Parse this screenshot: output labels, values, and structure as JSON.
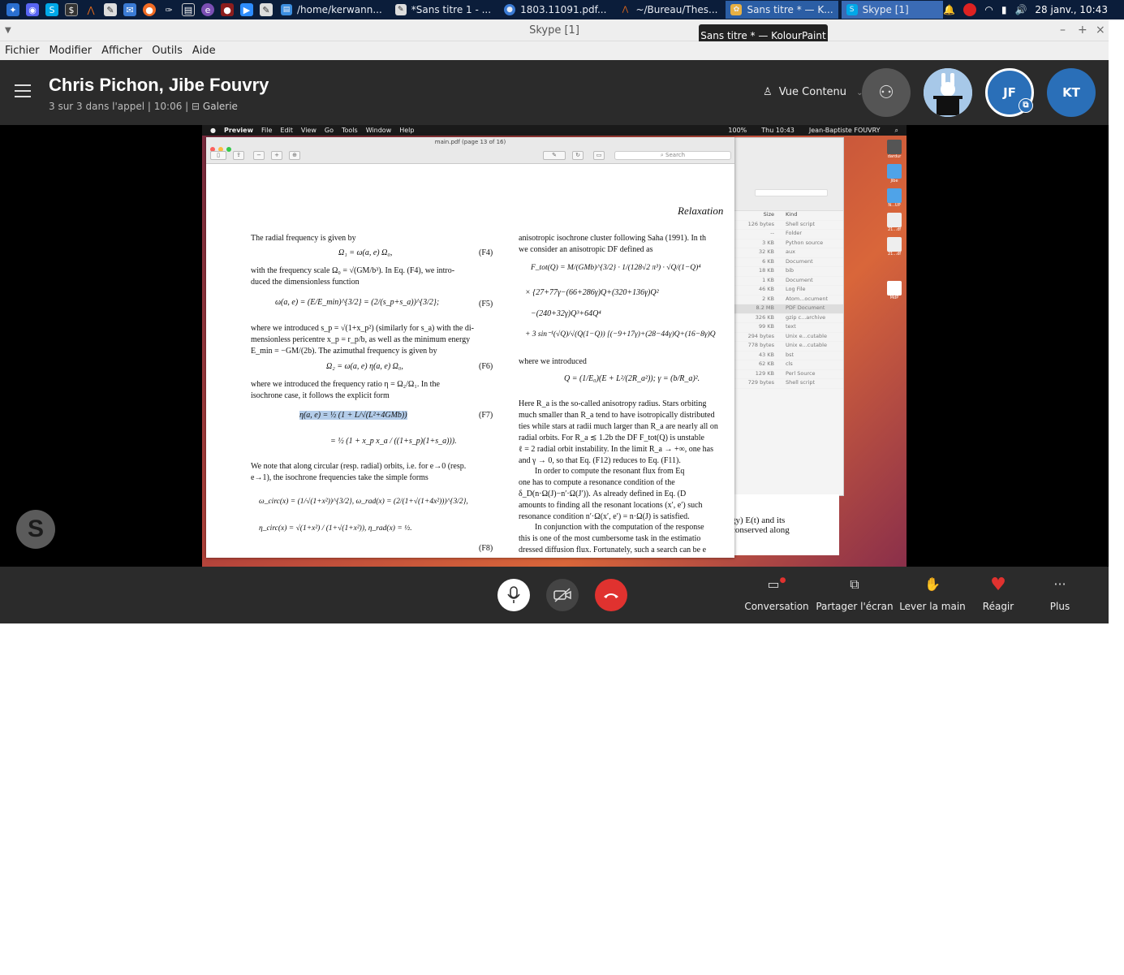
{
  "taskbar": {
    "tasks": [
      {
        "label": "/home/kerwann..."
      },
      {
        "label": "*Sans titre 1 - ..."
      },
      {
        "label": "1803.11091.pdf..."
      },
      {
        "label": "~/Bureau/Thes..."
      },
      {
        "label": "Sans titre * — K..."
      },
      {
        "label": "Skype [1]"
      }
    ],
    "clock": "28 janv., 10:43"
  },
  "window": {
    "title": "Skype [1]",
    "tooltip": "Sans titre * — KolourPaint",
    "menu": [
      "Fichier",
      "Modifier",
      "Afficher",
      "Outils",
      "Aide"
    ]
  },
  "call": {
    "title": "Chris Pichon, Jibe Fouvry",
    "subtitle": "3 sur 3 dans l'appel | 10:06 |",
    "gallery_label": "Galerie",
    "view_label": "Vue Contenu",
    "avatars": [
      {
        "initials": "JF",
        "color": "#ffffff"
      },
      {
        "initials": "KT",
        "color": "#ffffff"
      }
    ]
  },
  "shared_screen": {
    "mac_menu": [
      "Preview",
      "File",
      "Edit",
      "View",
      "Go",
      "Tools",
      "Window",
      "Help"
    ],
    "mac_status": "100%",
    "mac_clock": "Thu 10:43",
    "mac_user": "Jean-Baptiste FOUVRY",
    "preview_title": "main.pdf (page 13 of 16)",
    "search_placeholder": "Search",
    "finder_header": {
      "size": "Size",
      "kind": "Kind"
    },
    "finder_rows": [
      {
        "size": "126 bytes",
        "kind": "Shell script"
      },
      {
        "size": "--",
        "kind": "Folder"
      },
      {
        "size": "3 KB",
        "kind": "Python source"
      },
      {
        "size": "32 KB",
        "kind": "aux"
      },
      {
        "size": "6 KB",
        "kind": "Document"
      },
      {
        "size": "18 KB",
        "kind": "bib"
      },
      {
        "size": "1 KB",
        "kind": "Document"
      },
      {
        "size": "46 KB",
        "kind": "Log File"
      },
      {
        "size": "2 KB",
        "kind": "Atom...ocument"
      },
      {
        "size": "8.2 MB",
        "kind": "PDF Document"
      },
      {
        "size": "326 KB",
        "kind": "gzip c...archive"
      },
      {
        "size": "99 KB",
        "kind": "text"
      },
      {
        "size": "294 bytes",
        "kind": "Unix e...cutable"
      },
      {
        "size": "778 bytes",
        "kind": "Unix e...cutable"
      },
      {
        "size": "43 KB",
        "kind": "bst"
      },
      {
        "size": "62 KB",
        "kind": "cls"
      },
      {
        "size": "129 KB",
        "kind": "Perl Source"
      },
      {
        "size": "729 bytes",
        "kind": "Shell script"
      }
    ],
    "dock_labels": [
      "dardur",
      "Jibe",
      "N...UP",
      "21...df",
      "21...df",
      "MdP"
    ],
    "paper": {
      "running_head": "Relaxation",
      "left": [
        "The radial frequency is given by",
        "with the frequency scale Ω₀ = √(GM/b³). In Eq. (F4), we intro-",
        "duced the dimensionless function",
        "where we introduced s_p = √(1+x_p²) (similarly for s_a) with the di-",
        "mensionless pericentre x_p = r_p/b, as well as the minimum energy",
        "E_min = −GM/(2b). The azimuthal frequency is given by",
        "where we introduced the frequency ratio η = Ω₂/Ω₁. In the",
        "isochrone case, it follows the explicit form",
        "We note that along circular (resp. radial) orbits, i.e. for e→0 (resp.",
        "e→1), the isochrone frequencies take the simple forms"
      ],
      "right": [
        "anisotropic isochrone cluster following Saha (1991). In th",
        "we consider an anisotropic DF defined as",
        "where we introduced",
        "Here R_a is the so-called anisotropy radius. Stars orbiting",
        "much smaller than R_a tend to have isotropically distributed",
        "ties while stars at radii much larger than R_a are nearly all on",
        "radial orbits. For R_a ≲ 1.2b the DF F_tot(Q) is unstable",
        "ℓ = 2 radial orbit instability. In the limit R_a → +∞, one has",
        "and γ → 0, so that Eq. (F12) reduces to Eq. (F11).",
        "In order to compute the resonant flux from Eq",
        "one has to compute a resonance condition of the",
        "δ_D(n·Ω(J)−n′·Ω(J′)). As already defined in Eq. (D",
        "amounts to finding all the resonant locations (x′, e′) such",
        "resonance condition n′·Ω(x′, e′) = n·Ω(J) is satisfied.",
        "In conjunction with the computation of the response",
        "this is one of the most cumbersome task in the estimatio",
        "dressed diffusion flux. Fortunately, such a search can be e"
      ],
      "equations": {
        "F4": "Ω₁ = ω(a, e) Ω₀,",
        "F5": "ω(a, e) = (E/E_min)^{3/2} = (2/(s_p+s_a))^{3/2};",
        "F6": "Ω₂ = ω(a, e) η(a, e) Ω₀,",
        "F7a": "η(a, e) = ½ (1 + L/√(L²+4GMb))",
        "F7b": "= ½ (1 + x_p x_a / ((1+s_p)(1+s_a))).",
        "F8a": "ω_circ(x) = (1/√(1+x²))^{3/2},   ω_rad(x) = (2/(1+√(1+4x²)))^{3/2},",
        "F8b": "η_circ(x) = √(1+x²) / (1+√(1+x²)),   η_rad(x) = ½.",
        "Ftot1": "F_tot(Q) = M/(GMb)^{3/2} · 1/(128√2 π³) · √Q/(1−Q)⁴",
        "Ftot2": "× {27+77γ−(66+286γ)Q+(320+136γ)Q²",
        "Ftot3": "−(240+32γ)Q³+64Q⁴",
        "Ftot4": "+ 3 sin⁻¹(√Q)/√(Q(1−Q)) [(−9+17γ)+(28−44γ)Q+(16−8γ)Q",
        "Qdef": "Q = (1/E₀)(E + L²/(2R_a²));   γ = (b/R_a)²."
      },
      "labels": [
        "(F4)",
        "(F5)",
        "(F6)",
        "(F7)",
        "(F8)"
      ],
      "overflow": [
        "gy) E(t) and its",
        "conserved along"
      ]
    }
  },
  "controls": {
    "actions": [
      {
        "label": "Conversation"
      },
      {
        "label": "Partager l'écran"
      },
      {
        "label": "Lever la main"
      },
      {
        "label": "Réagir"
      },
      {
        "label": "Plus"
      }
    ]
  }
}
